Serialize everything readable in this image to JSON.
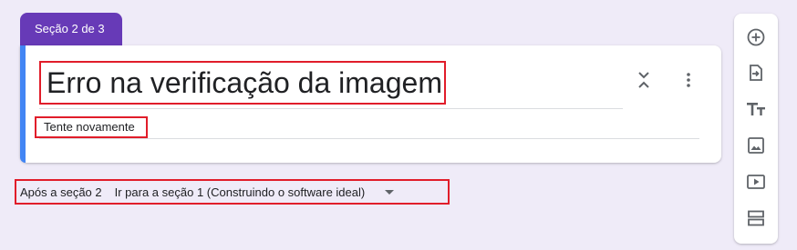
{
  "section_tab": {
    "label": "Seção 2 de 3"
  },
  "card": {
    "title": "Erro na verificação da imagem",
    "description": "Tente novamente",
    "accent_color": "#4285f4"
  },
  "after_section": {
    "label": "Após a seção 2",
    "selected": "Ir para a seção 1 (Construindo o software ideal)"
  },
  "toolbar": {
    "items": [
      {
        "icon": "add-circle-icon"
      },
      {
        "icon": "import-icon"
      },
      {
        "icon": "title-text-icon"
      },
      {
        "icon": "image-icon"
      },
      {
        "icon": "video-icon"
      },
      {
        "icon": "section-icon"
      }
    ]
  },
  "colors": {
    "background": "#efebf8",
    "brand": "#673ab7",
    "highlight": "#e11d2a",
    "icon": "#5f6368"
  }
}
